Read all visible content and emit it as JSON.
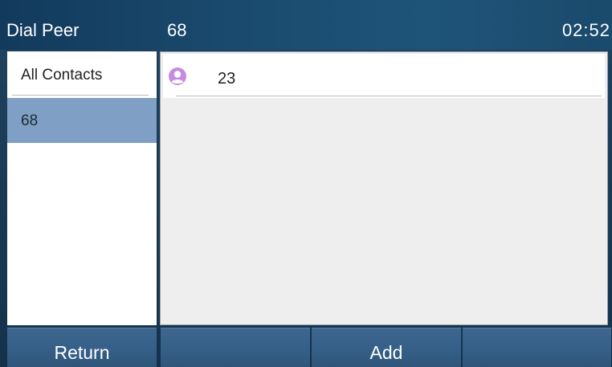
{
  "titlebar": {
    "app_title": "Dial Peer",
    "subtitle": "68",
    "time": "02:52"
  },
  "groups": [
    {
      "label": "All Contacts",
      "selected": false
    },
    {
      "label": "68",
      "selected": true
    }
  ],
  "contacts": [
    {
      "name": "23",
      "icon": "person-avatar-icon",
      "icon_color": "#c58be2"
    }
  ],
  "softkeys": {
    "k1": "Return",
    "k2": "",
    "k3": "Add",
    "k4": ""
  },
  "colors": {
    "titlebar": "#1a4b6f",
    "selection": "#7f9fc4",
    "softkey": "#355e86",
    "panel_bg": "#eeeeee"
  }
}
